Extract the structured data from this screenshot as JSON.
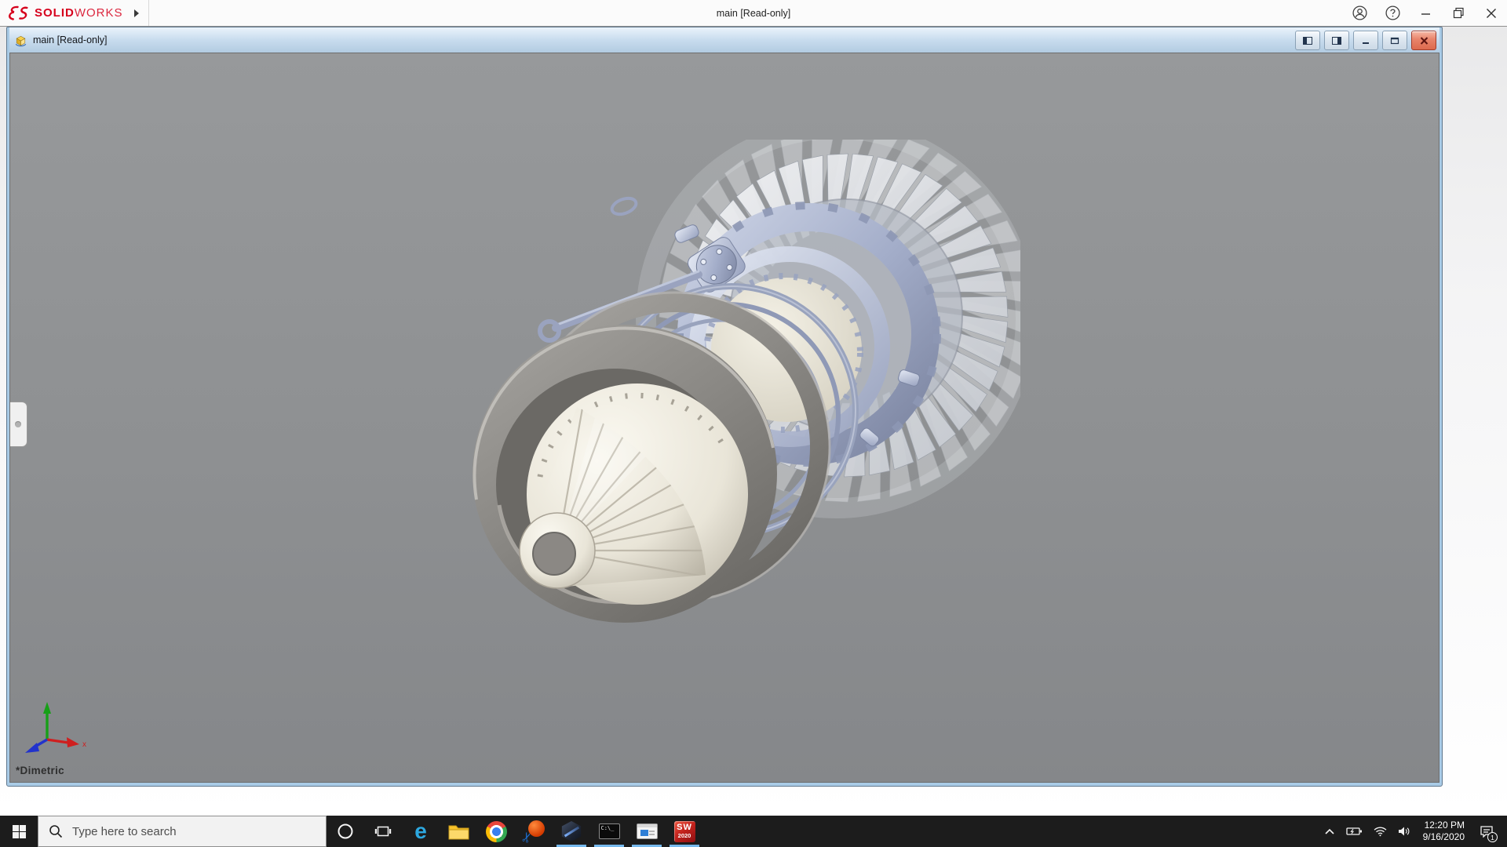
{
  "app": {
    "brand": {
      "name_bold": "SOLID",
      "name_light": "WORKS"
    },
    "window_title": "main [Read-only]",
    "titlebar_icons": [
      "account-icon",
      "help-icon",
      "minimize-icon",
      "restore-icon",
      "close-icon"
    ]
  },
  "doc": {
    "title": "main [Read-only]",
    "view_orientation": "*Dimetric",
    "triad_axis_label": "x",
    "window_buttons": [
      "split-left",
      "split-right",
      "minimize",
      "restore",
      "close"
    ]
  },
  "taskbar": {
    "search_placeholder": "Type here to search",
    "apps": [
      {
        "name": "cortana",
        "running": false
      },
      {
        "name": "task-view",
        "running": false
      },
      {
        "name": "edge",
        "running": false
      },
      {
        "name": "file-explorer",
        "running": false
      },
      {
        "name": "chrome",
        "running": false
      },
      {
        "name": "screen-capture",
        "running": false
      },
      {
        "name": "hexagon-app",
        "running": true
      },
      {
        "name": "command-prompt",
        "running": true
      },
      {
        "name": "system-window",
        "running": true
      },
      {
        "name": "solidworks-2020",
        "running": true
      }
    ],
    "solidworks_icon": {
      "letters": "SW",
      "year": "2020"
    },
    "tray": {
      "time": "12:20 PM",
      "date": "9/16/2020",
      "notification_count": "1"
    }
  },
  "colors": {
    "brand_red": "#d6001c",
    "doc_border_blue": "#a9cbe6",
    "viewport_gray_top": "#97999b",
    "viewport_gray_bottom": "#85878a",
    "taskbar_bg": "#1c1c1c",
    "running_indicator_blue": "#76b9ed",
    "close_button_red": "#dd6a4e",
    "model_steel_blue": "#a3adc9",
    "model_ivory": "#e9e5d8"
  }
}
